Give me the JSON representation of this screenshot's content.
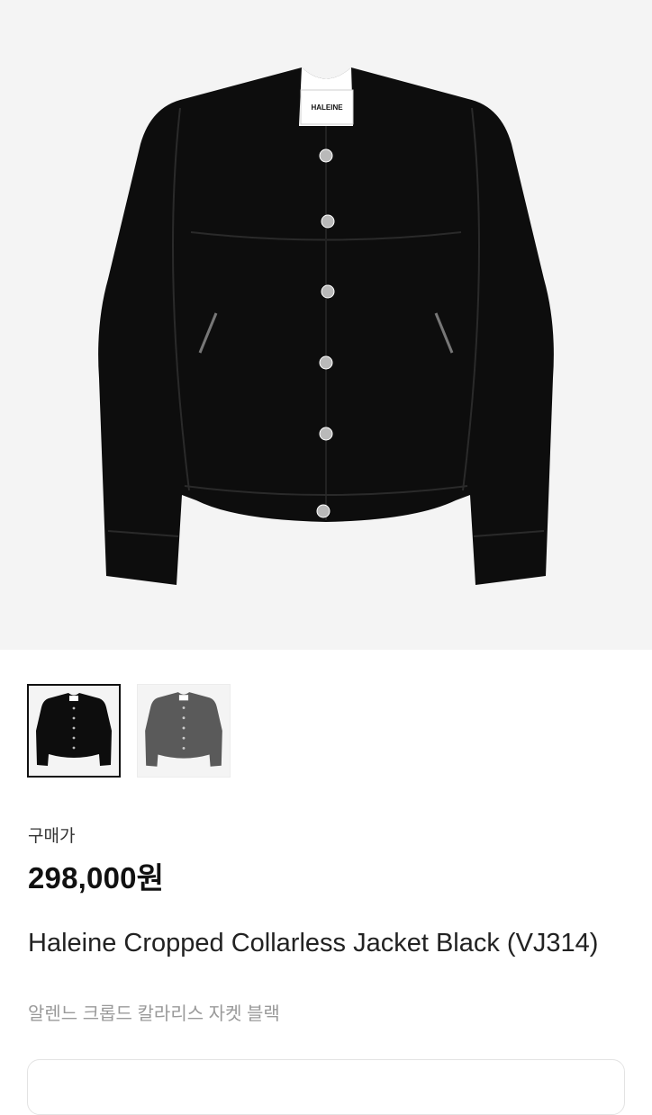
{
  "product": {
    "brand_tag": "HALEINE",
    "images": [
      {
        "name": "black",
        "color": "#0d0d0d",
        "selected": true
      },
      {
        "name": "grey",
        "color": "#5a5a5a",
        "selected": false
      }
    ],
    "price_label": "구매가",
    "price": "298,000원",
    "title_en": "Haleine Cropped Collarless Jacket Black (VJ314)",
    "title_ko": "알렌느 크롭드 칼라리스 자켓 블랙"
  },
  "colors": {
    "hero_bg": "#f4f4f4",
    "jacket_black": "#0d0d0d",
    "jacket_grey": "#5a5a5a"
  }
}
